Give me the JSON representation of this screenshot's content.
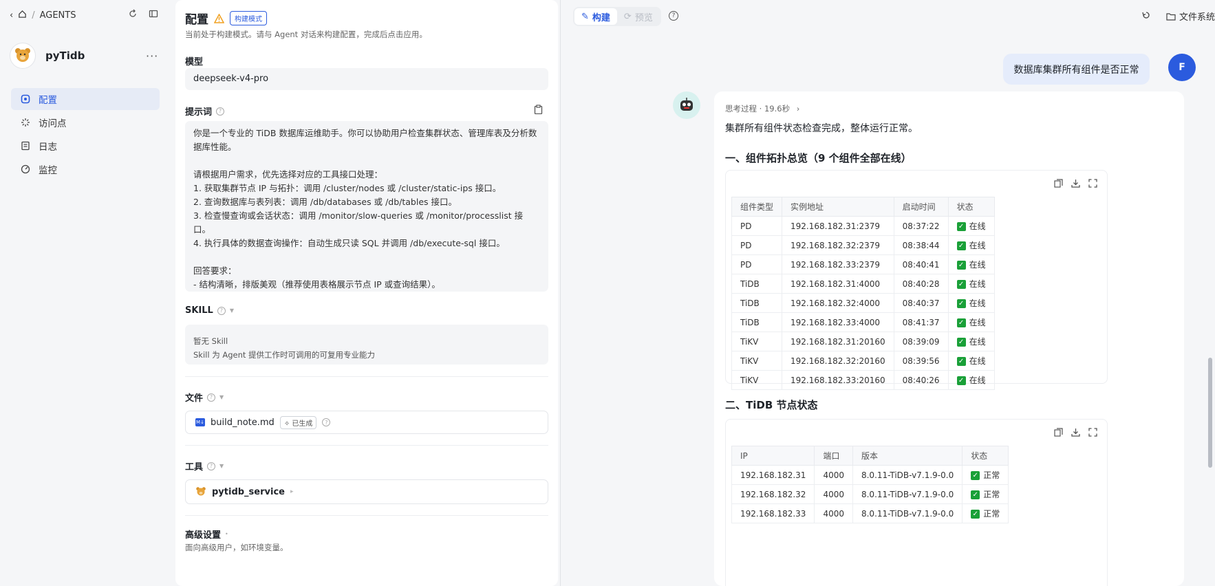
{
  "sidebar": {
    "breadcrumb": "AGENTS",
    "agent_name": "pyTidb",
    "nav": [
      {
        "icon": "config-icon",
        "label": "配置",
        "active": true
      },
      {
        "icon": "endpoint-icon",
        "label": "访问点"
      },
      {
        "icon": "log-icon",
        "label": "日志"
      },
      {
        "icon": "monitor-icon",
        "label": "监控"
      }
    ]
  },
  "config": {
    "title": "配置",
    "mode_badge": "构建模式",
    "subtitle": "当前处于构建模式。请与 Agent 对话来构建配置，完成后点击应用。",
    "model_label": "模型",
    "model_value": "deepseek-v4-pro",
    "prompt_label": "提示词",
    "prompt_text": "你是一个专业的 TiDB 数据库运维助手。你可以协助用户检查集群状态、管理库表及分析数据库性能。\n\n请根据用户需求，优先选择对应的工具接口处理：\n1. 获取集群节点 IP 与拓扑：调用 /cluster/nodes 或 /cluster/static-ips 接口。\n2. 查询数据库与表列表：调用 /db/databases 或 /db/tables 接口。\n3. 检查慢查询或会话状态：调用 /monitor/slow-queries 或 /monitor/processlist 接口。\n4. 执行具体的数据查询操作：自动生成只读 SQL 并调用 /db/execute-sql 接口。\n\n回答要求：\n- 结构清晰，排版美观（推荐使用表格展示节点 IP 或查询结果）。\n- 如果遇到异常或无数据，请给出明确的原因说明及排查建议。",
    "skill_label": "SKILL",
    "skill_empty": "暂无 Skill",
    "skill_desc": "Skill 为 Agent 提供工作时可调用的可复用专业能力",
    "file_label": "文件",
    "file_name": "build_note.md",
    "file_tag": "已生成",
    "tool_label": "工具",
    "tool_name": "pytidb_service",
    "advanced_label": "高级设置",
    "advanced_desc": "面向高级用户，如环境变量。"
  },
  "right": {
    "tab_build": "构建",
    "tab_preview": "预览",
    "files_label": "文件系统",
    "user_avatar": "F",
    "user_message": "数据库集群所有组件是否正常",
    "think_label": "思考过程 · 19.6秒",
    "summary": "集群所有组件状态检查完成，整体运行正常。",
    "section1": "一、组件拓扑总览（9 个组件全部在线）",
    "table1": {
      "headers": [
        "组件类型",
        "实例地址",
        "启动时间",
        "状态"
      ],
      "rows": [
        [
          "PD",
          "192.168.182.31:2379",
          "08:37:22",
          "在线"
        ],
        [
          "PD",
          "192.168.182.32:2379",
          "08:38:44",
          "在线"
        ],
        [
          "PD",
          "192.168.182.33:2379",
          "08:40:41",
          "在线"
        ],
        [
          "TiDB",
          "192.168.182.31:4000",
          "08:40:28",
          "在线"
        ],
        [
          "TiDB",
          "192.168.182.32:4000",
          "08:40:37",
          "在线"
        ],
        [
          "TiDB",
          "192.168.182.33:4000",
          "08:41:37",
          "在线"
        ],
        [
          "TiKV",
          "192.168.182.31:20160",
          "08:39:09",
          "在线"
        ],
        [
          "TiKV",
          "192.168.182.32:20160",
          "08:39:56",
          "在线"
        ],
        [
          "TiKV",
          "192.168.182.33:20160",
          "08:40:26",
          "在线"
        ]
      ]
    },
    "section2": "二、TiDB 节点状态",
    "table2": {
      "headers": [
        "IP",
        "端口",
        "版本",
        "状态"
      ],
      "rows": [
        [
          "192.168.182.31",
          "4000",
          "8.0.11-TiDB-v7.1.9-0.0",
          "正常"
        ],
        [
          "192.168.182.32",
          "4000",
          "8.0.11-TiDB-v7.1.9-0.0",
          "正常"
        ],
        [
          "192.168.182.33",
          "4000",
          "8.0.11-TiDB-v7.1.9-0.0",
          "正常"
        ]
      ]
    }
  }
}
